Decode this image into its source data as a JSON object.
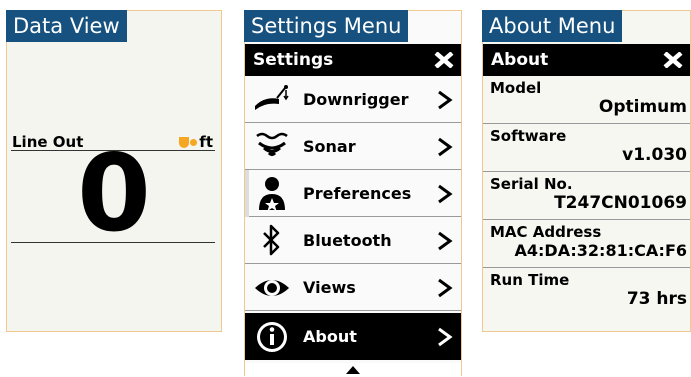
{
  "data_view": {
    "tag": "Data View",
    "label": "Line Out",
    "unit": "ft",
    "value": "0"
  },
  "settings_menu": {
    "tag": "Settings Menu",
    "title": "Settings",
    "items": [
      {
        "label": "Downrigger",
        "icon": "downrigger-icon"
      },
      {
        "label": "Sonar",
        "icon": "sonar-icon"
      },
      {
        "label": "Preferences",
        "icon": "preferences-icon"
      },
      {
        "label": "Bluetooth",
        "icon": "bluetooth-icon"
      },
      {
        "label": "Views",
        "icon": "eye-icon"
      },
      {
        "label": "About",
        "icon": "info-icon",
        "selected": true
      }
    ]
  },
  "about_menu": {
    "tag": "About Menu",
    "title": "About",
    "rows": [
      {
        "key": "Model",
        "value": "Optimum"
      },
      {
        "key": "Software",
        "value": "v1.030"
      },
      {
        "key": "Serial No.",
        "value": "T247CN01069"
      },
      {
        "key": "MAC Address",
        "value": "A4:DA:32:81:CA:F6"
      },
      {
        "key": "Run Time",
        "value": "73 hrs"
      }
    ]
  },
  "colors": {
    "tag_bg": "#16517f",
    "accent": "#f5a623",
    "bar": "#000000"
  }
}
